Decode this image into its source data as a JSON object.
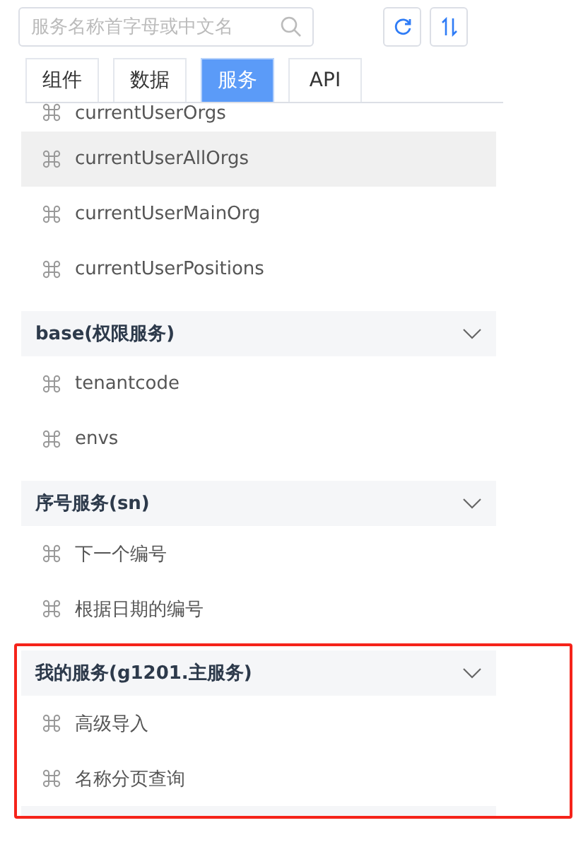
{
  "search": {
    "placeholder": "服务名称首字母或中文名"
  },
  "tool_buttons": [
    {
      "kind": "refresh"
    },
    {
      "kind": "sort"
    }
  ],
  "tabs": [
    {
      "label": "组件",
      "selected": false
    },
    {
      "label": "数据",
      "selected": false
    },
    {
      "label": "服务",
      "selected": true
    },
    {
      "label": "API",
      "selected": false
    }
  ],
  "groups": [
    {
      "items": [
        {
          "label": "currentUserOrgs",
          "selected": false
        },
        {
          "label": "currentUserAllOrgs",
          "selected": true
        },
        {
          "label": "currentUserMainOrg",
          "selected": false
        },
        {
          "label": "currentUserPositions",
          "selected": false
        }
      ]
    },
    {
      "title": "base(权限服务)",
      "expanded": true,
      "highlighted": false,
      "items": [
        {
          "label": "tenantcode",
          "selected": false
        },
        {
          "label": "envs",
          "selected": false
        }
      ]
    },
    {
      "title": "序号服务(sn)",
      "expanded": true,
      "highlighted": false,
      "items": [
        {
          "label": "下一个编号",
          "selected": false
        },
        {
          "label": "根据日期的编号",
          "selected": false
        }
      ]
    },
    {
      "title": "我的服务(g1201.主服务)",
      "expanded": true,
      "highlighted": true,
      "items": [
        {
          "label": "高级导入",
          "selected": false
        },
        {
          "label": "名称分页查询",
          "selected": false
        }
      ]
    }
  ]
}
